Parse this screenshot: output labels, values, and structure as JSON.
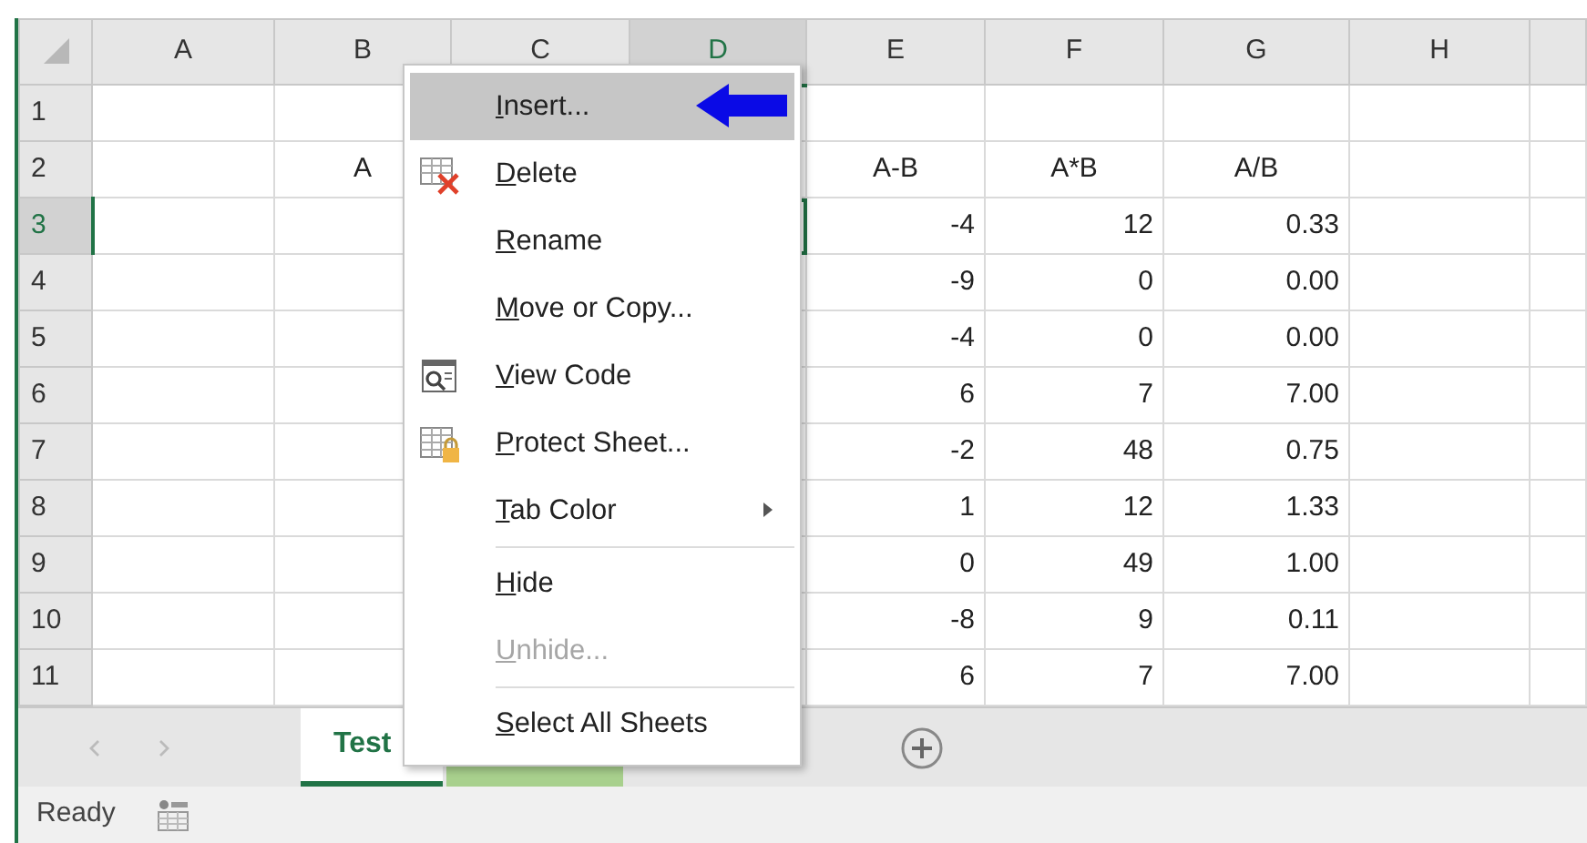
{
  "columns": [
    {
      "label": "A",
      "selected": false
    },
    {
      "label": "B",
      "selected": false
    },
    {
      "label": "C",
      "selected": false
    },
    {
      "label": "D",
      "selected": true
    },
    {
      "label": "E",
      "selected": false
    },
    {
      "label": "F",
      "selected": false
    },
    {
      "label": "G",
      "selected": false
    },
    {
      "label": "H",
      "selected": false
    }
  ],
  "rows": [
    {
      "header": "1",
      "selected": false,
      "kind": "text",
      "cells": [
        null,
        null,
        null,
        null,
        null,
        null,
        null,
        null
      ]
    },
    {
      "header": "2",
      "selected": false,
      "kind": "text",
      "cells": [
        null,
        "A",
        null,
        null,
        "A-B",
        "A*B",
        "A/B",
        null
      ]
    },
    {
      "header": "3",
      "selected": true,
      "kind": "number",
      "cells": [
        null,
        null,
        null,
        null,
        "-4",
        "12",
        "0.33",
        null
      ]
    },
    {
      "header": "4",
      "selected": false,
      "kind": "number",
      "cells": [
        null,
        null,
        null,
        null,
        "-9",
        "0",
        "0.00",
        null
      ]
    },
    {
      "header": "5",
      "selected": false,
      "kind": "number",
      "cells": [
        null,
        null,
        null,
        null,
        "-4",
        "0",
        "0.00",
        null
      ]
    },
    {
      "header": "6",
      "selected": false,
      "kind": "number",
      "cells": [
        null,
        null,
        null,
        null,
        "6",
        "7",
        "7.00",
        null
      ]
    },
    {
      "header": "7",
      "selected": false,
      "kind": "number",
      "cells": [
        null,
        null,
        null,
        null,
        "-2",
        "48",
        "0.75",
        null
      ]
    },
    {
      "header": "8",
      "selected": false,
      "kind": "number",
      "cells": [
        null,
        null,
        null,
        null,
        "1",
        "12",
        "1.33",
        null
      ]
    },
    {
      "header": "9",
      "selected": false,
      "kind": "number",
      "cells": [
        null,
        null,
        null,
        null,
        "0",
        "49",
        "1.00",
        null
      ]
    },
    {
      "header": "10",
      "selected": false,
      "kind": "number",
      "cells": [
        null,
        null,
        null,
        null,
        "-8",
        "9",
        "0.11",
        null
      ]
    },
    {
      "header": "11",
      "selected": false,
      "kind": "number",
      "cells": [
        null,
        null,
        null,
        null,
        "6",
        "7",
        "7.00",
        null
      ]
    }
  ],
  "context_menu": [
    {
      "kind": "plain",
      "access_key": "I",
      "label_rest": "nsert...",
      "selected": true,
      "pointed": true,
      "disabled": false
    },
    {
      "kind": "delete",
      "access_key": "D",
      "label_rest": "elete",
      "selected": false,
      "disabled": false
    },
    {
      "kind": "plain",
      "access_key": "R",
      "label_rest": "ename",
      "selected": false,
      "disabled": false
    },
    {
      "kind": "plain",
      "access_key": "M",
      "label_rest": "ove or Copy...",
      "selected": false,
      "disabled": false
    },
    {
      "kind": "view-code",
      "access_key": "V",
      "label_rest": "iew Code",
      "selected": false,
      "disabled": false
    },
    {
      "kind": "protect",
      "access_key": "P",
      "label_rest": "rotect Sheet...",
      "selected": false,
      "disabled": false
    },
    {
      "kind": "plain",
      "access_key": "T",
      "label_rest": "ab Color",
      "submenu": true,
      "selected": false,
      "disabled": false
    },
    {
      "kind": "separator"
    },
    {
      "kind": "plain",
      "access_key": "H",
      "label_rest": "ide",
      "selected": false,
      "disabled": false
    },
    {
      "kind": "plain",
      "access_key": "U",
      "label_rest": "nhide...",
      "selected": false,
      "disabled": true
    },
    {
      "kind": "separator"
    },
    {
      "kind": "plain",
      "access_key": "S",
      "label_rest": "elect All Sheets",
      "selected": false,
      "disabled": false
    }
  ],
  "sheet_tabs": [
    {
      "label": "Test",
      "selected": true
    },
    {
      "selected": false,
      "color": "#a8d08d"
    }
  ],
  "status_bar": {
    "text": "Ready"
  }
}
